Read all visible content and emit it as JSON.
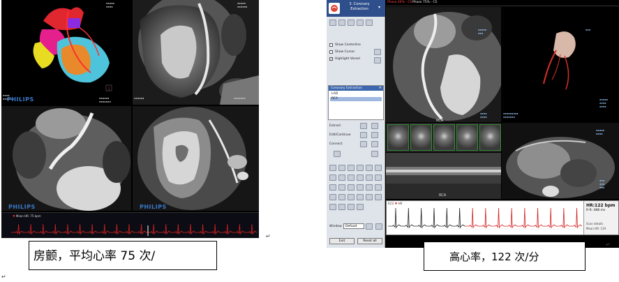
{
  "left_panel": {
    "brand": "PHILIPS",
    "ecg_strip_text": "Mean HR: 75 bpm",
    "caption": "房颤，平均心率 75 次/"
  },
  "right_panel": {
    "toolbar": {
      "title": "3. Coronary Extraction",
      "options": [
        "Show Centerline",
        "Show Cursor",
        "Highlight Vessel"
      ],
      "list_title": "Coronary Extraction",
      "list_items": [
        "LAD",
        "RCA"
      ],
      "actions": [
        "Extract",
        "Edit/Continue",
        "Connect"
      ],
      "window_label": "Window",
      "window_value": "Default",
      "exit_label": "Exit",
      "reset_label": "Reset all"
    },
    "tabs": [
      "Phase 46% - CS",
      "Phase 75% - CS"
    ],
    "vessel_label": "RCA",
    "heart_rate": "HR:122 bpm",
    "rr": "R-R: 488 ms",
    "scan_details": "Scan details",
    "mean_hr": "Mean HR: 119",
    "ecg_tabs": [
      "ECG",
      "HR"
    ],
    "caption": "高心率，122 次/分"
  },
  "colors": {
    "ecg_red": "#d42020",
    "ecg_black": "#222222",
    "philips_blue": "#3a78c8",
    "toolbar_blue": "#2e4f8c"
  }
}
